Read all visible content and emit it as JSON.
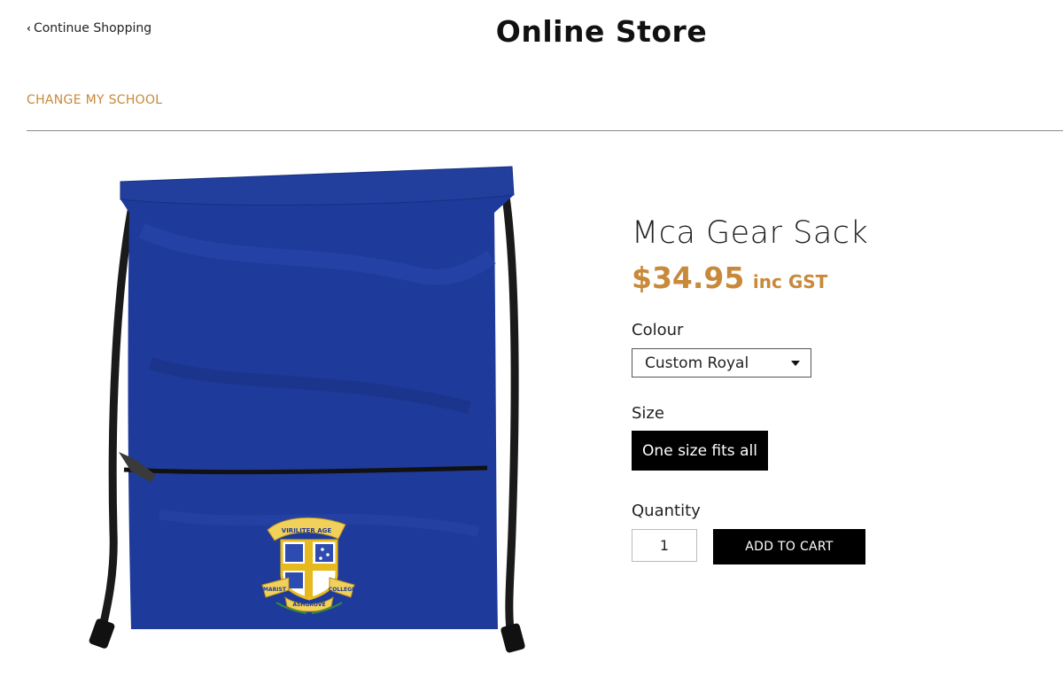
{
  "header": {
    "continue_label": "Continue Shopping",
    "title": "Online Store",
    "change_school_label": "CHANGE MY SCHOOL"
  },
  "product": {
    "name": "Mca Gear Sack",
    "price": "$34.95",
    "tax_note": "inc GST",
    "colour_label": "Colour",
    "colour_selected": "Custom Royal",
    "size_label": "Size",
    "size_selected": "One size fits all",
    "quantity_label": "Quantity",
    "quantity_value": "1",
    "add_to_cart_label": "ADD TO CART",
    "emblem_text": {
      "top": "VIRILITER AGE",
      "left": "MARIST",
      "right": "COLLEGE",
      "bottom": "ASHGROVE"
    }
  },
  "colors": {
    "accent": "#c8893a",
    "bag_blue": "#1e3a9a",
    "button_bg": "#000000"
  }
}
